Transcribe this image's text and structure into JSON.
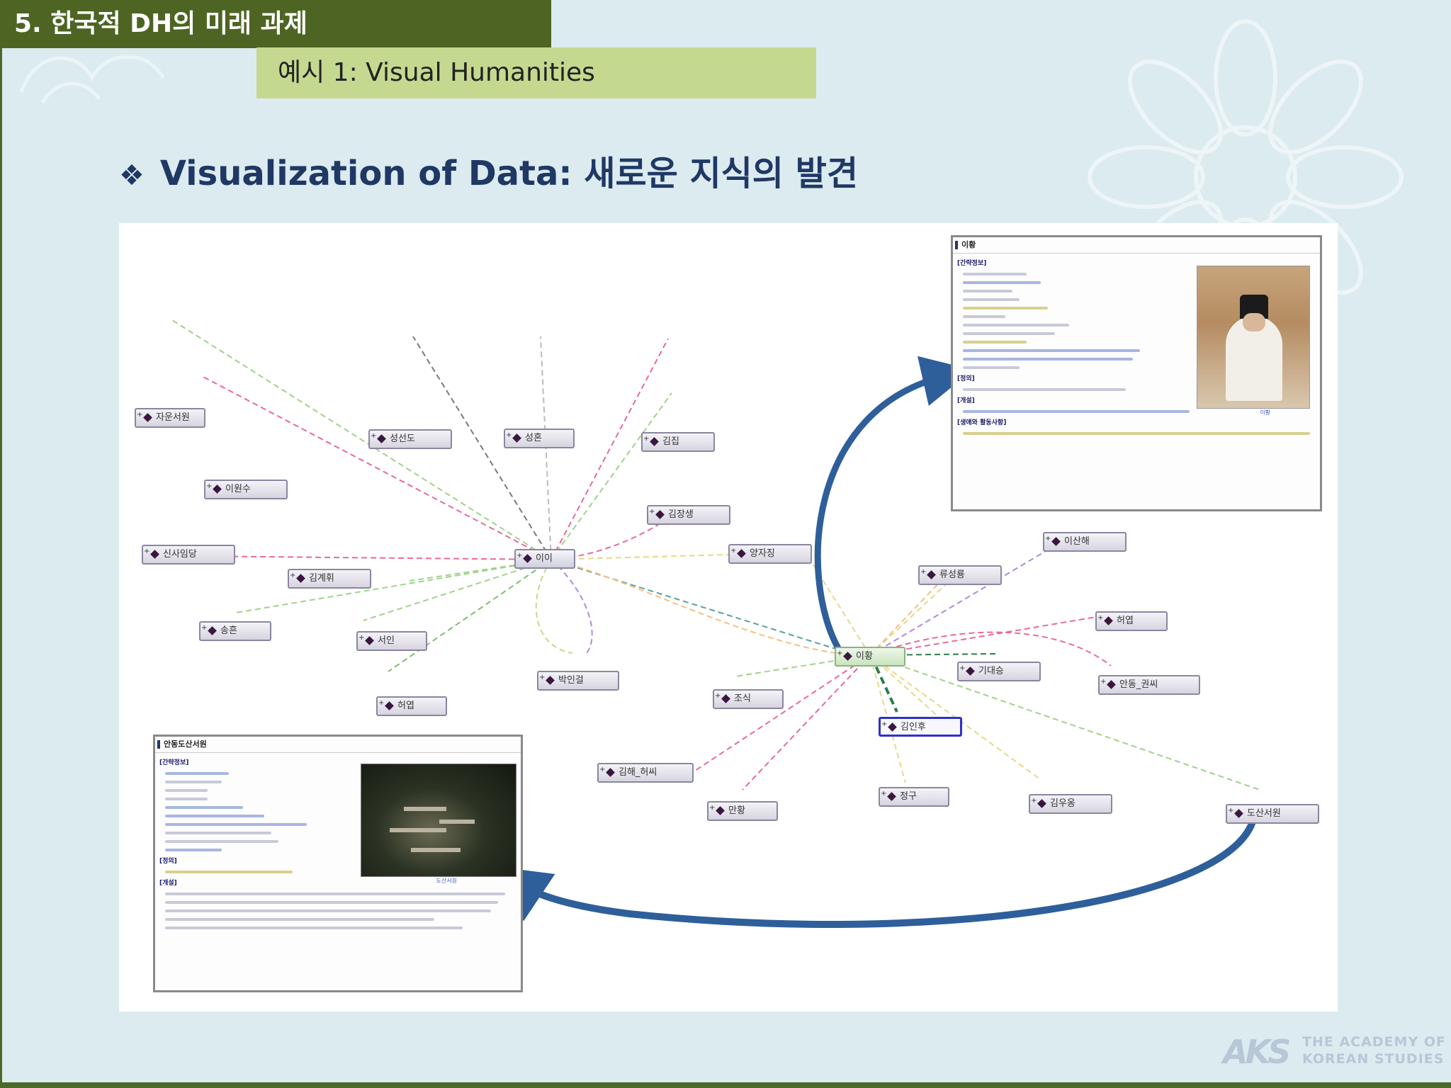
{
  "header": {
    "section_label": "5. 한국적 DH의 미래 과제",
    "subtitle": "예시 1: Visual Humanities"
  },
  "heading": {
    "bullet": "❖",
    "text": "Visualization of Data: 새로운 지식의 발견"
  },
  "colors": {
    "section_bar": "#4d6423",
    "subtitle_bar": "#c4d98f",
    "heading_text": "#1f3864",
    "arrow_blue": "#2e5f9a"
  },
  "graph": {
    "nodes": [
      {
        "id": "yi_i",
        "label": "이이",
        "kind": "center-a"
      },
      {
        "id": "yi_hwang",
        "label": "이황",
        "kind": "center-b"
      },
      {
        "id": "jaun",
        "label": "자운서원"
      },
      {
        "id": "ihwonsu",
        "label": "이원수"
      },
      {
        "id": "sinsaimdang",
        "label": "신사임당"
      },
      {
        "id": "songyu",
        "label": "송흔"
      },
      {
        "id": "seongseondo",
        "label": "성선도"
      },
      {
        "id": "seonghon",
        "label": "성혼"
      },
      {
        "id": "gimjip",
        "label": "김집"
      },
      {
        "id": "gimjangsaeng",
        "label": "김장생"
      },
      {
        "id": "gimgyehwi",
        "label": "김계휘"
      },
      {
        "id": "seoin",
        "label": "서인"
      },
      {
        "id": "heoyeop",
        "label": "허엽"
      },
      {
        "id": "bakingyeol",
        "label": "박인걸"
      },
      {
        "id": "yangjajing",
        "label": "양자징"
      },
      {
        "id": "yuseongryong",
        "label": "류성룡"
      },
      {
        "id": "isanhae",
        "label": "이산해"
      },
      {
        "id": "heoyeob2",
        "label": "허엽"
      },
      {
        "id": "gidaeseung",
        "label": "기대승"
      },
      {
        "id": "andong",
        "label": "안동_권씨"
      },
      {
        "id": "josik",
        "label": "조식"
      },
      {
        "id": "gimhu",
        "label": "김인후",
        "kind": "selected"
      },
      {
        "id": "gimhaeheo",
        "label": "김해_허씨"
      },
      {
        "id": "manhwang",
        "label": "만황"
      },
      {
        "id": "jeonggu",
        "label": "정구"
      },
      {
        "id": "gimuong",
        "label": "김우옹"
      },
      {
        "id": "dosan",
        "label": "도산서원"
      }
    ]
  },
  "panel_person": {
    "title": "이황",
    "section1": "[간략정보]",
    "section2": "[정의]",
    "section3": "[개설]",
    "section4": "[생애와 활동사항]",
    "photo_caption": "이황"
  },
  "panel_place": {
    "title": "안동도산서원",
    "section1": "[간략정보]",
    "section2": "[정의]",
    "section3": "[개설]",
    "photo_caption": "도산서원"
  },
  "logo": {
    "mark": "AKS",
    "line1": "THE ACADEMY OF",
    "line2": "KOREAN STUDIES"
  }
}
